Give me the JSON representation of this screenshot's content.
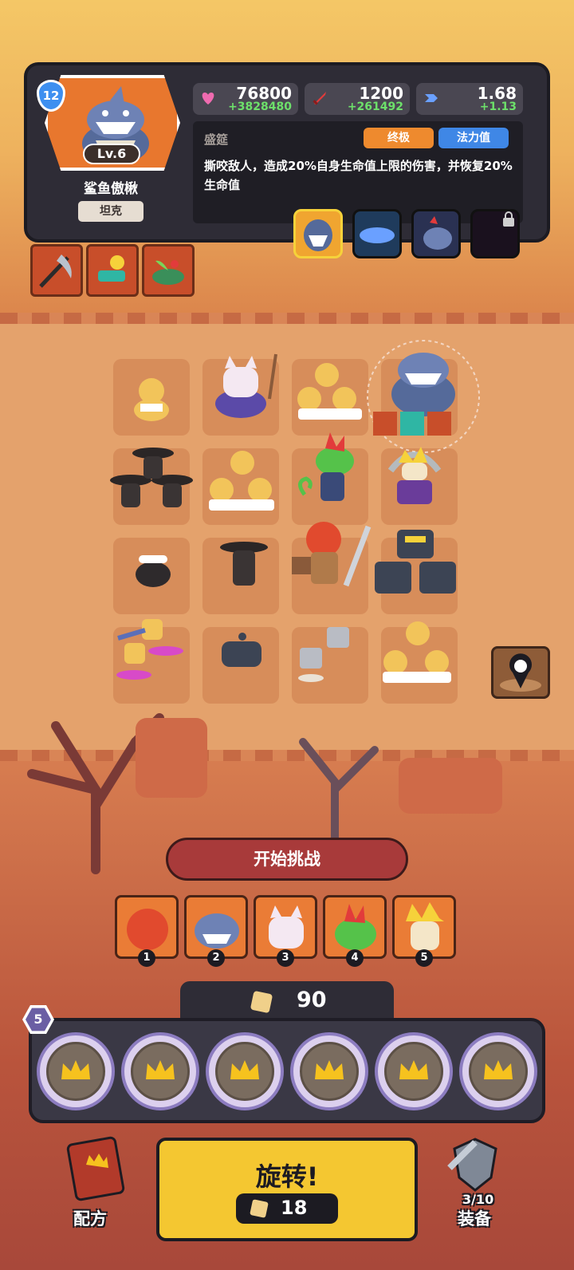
{
  "hero": {
    "level_badge": "12",
    "level": "Lv.6",
    "name": "鲨鱼傲楸",
    "role": "坦克",
    "stats": {
      "health": "76800",
      "health_bonus": "+3828480",
      "attack": "1200",
      "attack_bonus": "+261492",
      "speed": "1.68",
      "speed_bonus": "+1.13"
    },
    "skill": {
      "name": "盛筵",
      "tag_ultimate": "终极",
      "tag_mana": "法力值",
      "description": "撕咬敌人，造成20%自身生命值上限的伤害，并恢复20%生命值"
    }
  },
  "battle": {
    "start_button": "开始挑战",
    "team_numbers": [
      "1",
      "2",
      "3",
      "4",
      "5"
    ]
  },
  "economy": {
    "gold": "90",
    "slot_count": "5",
    "spin_label": "旋转!",
    "spin_cost": "18"
  },
  "nav": {
    "recipe_label": "配方",
    "equipment_label": "装备",
    "equipment_count": "3/10"
  },
  "colors": {
    "panel": "#2e2c36",
    "accent_orange": "#e8772e",
    "bonus_green": "#6de06a",
    "spin_yellow": "#f4c731",
    "mana_blue": "#3f87e6"
  }
}
